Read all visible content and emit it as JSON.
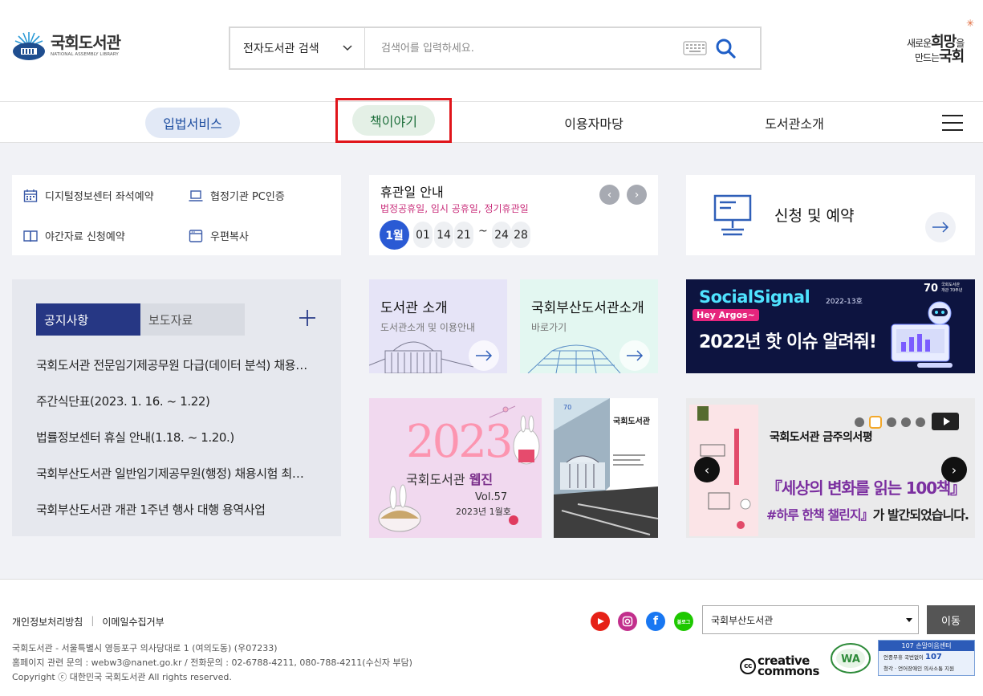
{
  "header": {
    "logo_kr": "국회도서관",
    "logo_en": "NATIONAL ASSEMBLY LIBRARY",
    "search_scope": "전자도서관 검색",
    "search_placeholder": "검색어를 입력하세요.",
    "slogan_line1_a": "새로운",
    "slogan_line1_b": "희망",
    "slogan_line1_c": "을",
    "slogan_line2_a": "만드는",
    "slogan_line2_b": "국회"
  },
  "gnb": {
    "items": [
      "입법서비스",
      "책이야기",
      "이용자마당",
      "도서관소개"
    ]
  },
  "quick": {
    "items": [
      "디지털정보센터 좌석예약",
      "협정기관 PC인증",
      "야간자료 신청예약",
      "우편복사"
    ]
  },
  "holiday": {
    "title": "휴관일 안내",
    "subtitle": "법정공휴일, 임시 공휴일, 정기휴관일",
    "month": "1월",
    "days": [
      "01",
      "14",
      "21",
      "24",
      "28"
    ],
    "range_sep": "~"
  },
  "apply": {
    "label": "신청 및 예약"
  },
  "notice": {
    "tabs": [
      "공지사항",
      "보도자료"
    ],
    "items": [
      "국회도서관 전문임기제공무원 다급(데이터 분석) 채용시험 최종합격자 공고",
      "주간식단표(2023. 1. 16. ~ 1.22)",
      "법률정보센터 휴실 안내(1.18. ~ 1.20.)",
      "국회부산도서관 일반임기제공무원(행정) 채용시험 최종합격자 공고",
      "국회부산도서관 개관 1주년 행사 대행 용역사업"
    ]
  },
  "cards": {
    "intro_title": "도서관 소개",
    "intro_sub": "도서관소개 및 이용안내",
    "busan_title": "국회부산도서관소개",
    "busan_sub": "바로가기"
  },
  "social": {
    "logo": "SocialSignal",
    "issue": "2022-13호",
    "hey": "Hey Argos~",
    "headline": "2022년 핫 이슈 알려줘!",
    "badge": "70",
    "badge_sub1": "국회도서관",
    "badge_sub2": "개관 70주년"
  },
  "webzine": {
    "year": "2023",
    "title_a": "국회도서관 ",
    "title_b": "웹진",
    "vol": "Vol.57",
    "issue": "2023년 1월호"
  },
  "book": {
    "title": "국회도서관"
  },
  "carousel": {
    "heading": "국회도서관 금주의서평",
    "line1": "『세상의 변화를 읽는 100책』",
    "line2_a": "#하루 한책 챌린지』",
    "line2_b": "가 발간되었습니다."
  },
  "footer": {
    "links": [
      "개인정보처리방침",
      "이메일수집거부"
    ],
    "address": "국회도서관 - 서울특별시 영등포구 의사당대로 1 (여의도동) (우07233)",
    "contact": "홈페이지 관련 문의 : webw3@nanet.go.kr / 전화문의 : 02-6788-4211, 080-788-4211(수신자 부담)",
    "copyright": "Copyright ⓒ 대한민국 국회도서관 All rights reserved.",
    "site_select": "국회부산도서관",
    "go_button": "이동",
    "blog_label": "블로그",
    "cc_line1": "creative",
    "cc_line2": "commons",
    "center_title": "107 손말이음센터",
    "center_line1_a": "언중무휴 국번없이 ",
    "center_line1_b": "107",
    "center_line2": "청각 · 언어장애인 의사소통 지원"
  }
}
